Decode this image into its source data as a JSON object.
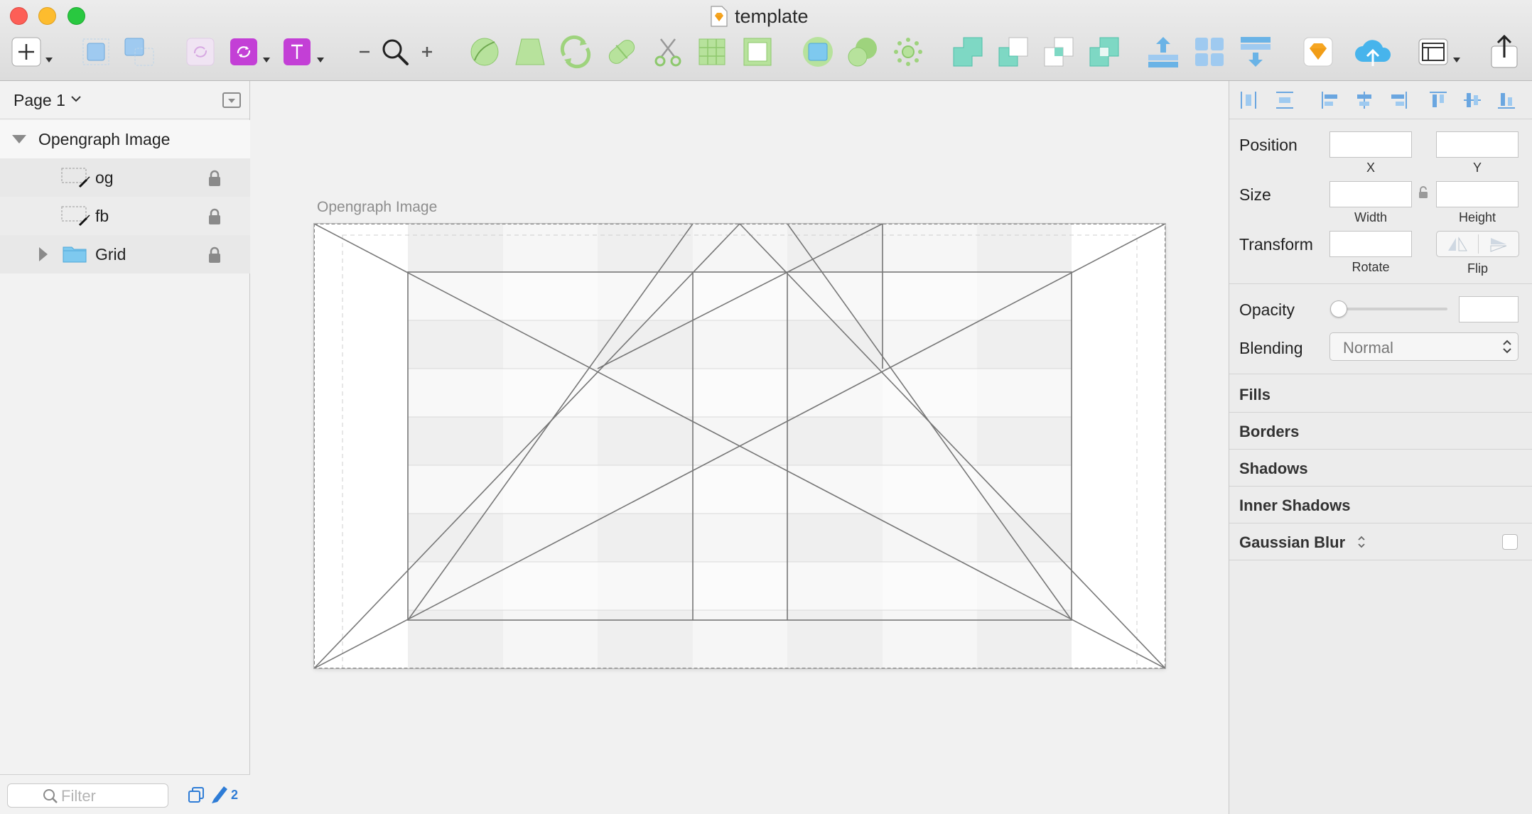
{
  "window": {
    "title": "template"
  },
  "toolbar": {
    "items": [
      "insert",
      "group",
      "ungroup",
      "create-symbol",
      "override",
      "text",
      "zoom-out",
      "zoom",
      "zoom-in",
      "edit",
      "transform",
      "rotate",
      "flatten",
      "scissors",
      "make-grid",
      "mask",
      "scale",
      "union",
      "subtract",
      "intersect",
      "difference",
      "forward",
      "backward",
      "mirror",
      "cloud",
      "view",
      "export"
    ]
  },
  "sidebar": {
    "page_label": "Page 1",
    "layers": [
      {
        "name": "Opengraph Image",
        "type": "artboard"
      },
      {
        "name": "og",
        "type": "slice",
        "locked": true
      },
      {
        "name": "fb",
        "type": "slice",
        "locked": true
      },
      {
        "name": "Grid",
        "type": "group",
        "locked": true
      }
    ],
    "filter_placeholder": "Filter",
    "filter_count": "2"
  },
  "canvas": {
    "artboard_label": "Opengraph Image"
  },
  "inspector": {
    "position_label": "Position",
    "x_label": "X",
    "y_label": "Y",
    "size_label": "Size",
    "width_label": "Width",
    "height_label": "Height",
    "transform_label": "Transform",
    "rotate_label": "Rotate",
    "flip_label": "Flip",
    "opacity_label": "Opacity",
    "opacity_level": 0,
    "blending_label": "Blending",
    "blending_value": "Normal",
    "sections": [
      "Fills",
      "Borders",
      "Shadows",
      "Inner Shadows",
      "Gaussian Blur"
    ]
  },
  "colors": {
    "accent_blue": "#2e7cd6",
    "symbol_purple": "#c33fd6",
    "shape_green": "#8dd36b",
    "boolean_teal": "#5ed0bd",
    "sketch_orange": "#f6a623"
  }
}
